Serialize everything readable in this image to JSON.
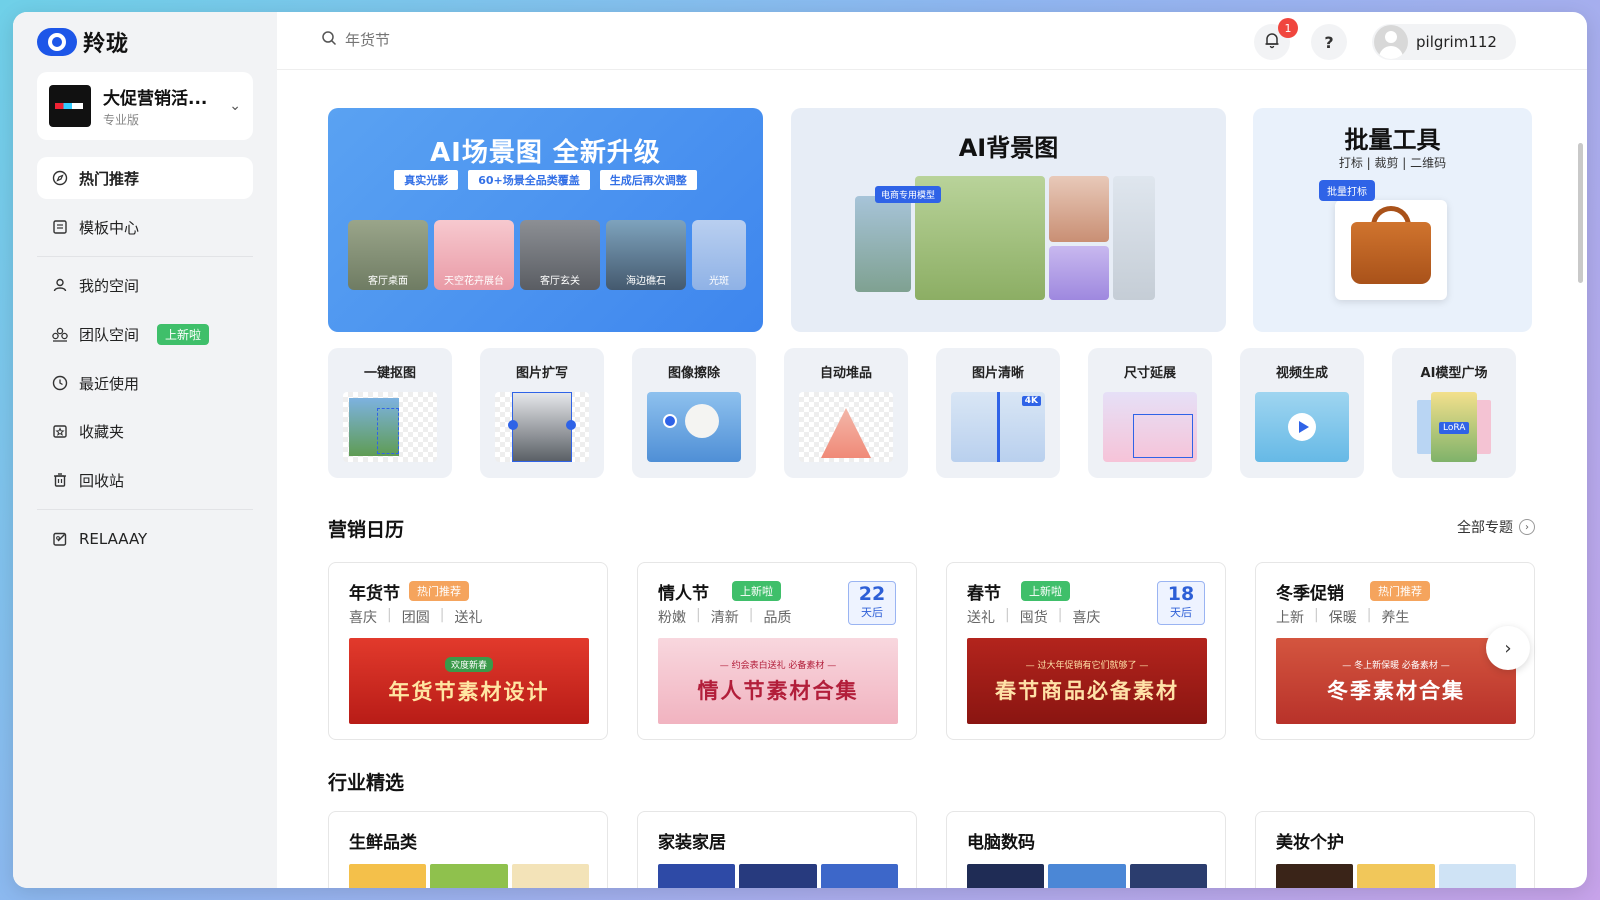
{
  "app": {
    "name": "羚珑"
  },
  "workspace": {
    "name": "大促营销活...",
    "plan": "专业版"
  },
  "sidebar": {
    "items": [
      {
        "label": "热门推荐",
        "icon": "compass-icon",
        "active": true
      },
      {
        "label": "模板中心",
        "icon": "template-icon"
      },
      {
        "label": "我的空间",
        "icon": "user-icon"
      },
      {
        "label": "团队空间",
        "icon": "team-icon",
        "badge": "上新啦"
      },
      {
        "label": "最近使用",
        "icon": "clock-icon"
      },
      {
        "label": "收藏夹",
        "icon": "star-folder-icon"
      },
      {
        "label": "回收站",
        "icon": "trash-icon"
      },
      {
        "label": "RELAAAY",
        "icon": "edit-square-icon"
      }
    ]
  },
  "header": {
    "search_placeholder": "年货节",
    "notification_count": "1",
    "help_label": "?",
    "username": "pilgrim112"
  },
  "banners": {
    "scene": {
      "title": "AI场景图 全新升级",
      "tags": [
        "真实光影",
        "60+场景全品类覆盖",
        "生成后再次调整"
      ],
      "thumbs": [
        "客厅桌面",
        "天空花卉展台",
        "客厅玄关",
        "海边礁石",
        "光斑"
      ]
    },
    "background": {
      "title": "AI背景图",
      "tag": "电商专用模型"
    },
    "batch": {
      "title": "批量工具",
      "subtitle": "打标 | 裁剪 | 二维码",
      "tag": "批量打标"
    }
  },
  "tools": [
    "一键抠图",
    "图片扩写",
    "图像擦除",
    "自动堆品",
    "图片清晰",
    "尺寸延展",
    "视频生成",
    "AI模型广场"
  ],
  "tool_badges": {
    "clarity": "4K",
    "model": "LoRA"
  },
  "calendar": {
    "title": "营销日历",
    "all_link": "全部专题",
    "cards": [
      {
        "name": "年货节",
        "badge": "热门推荐",
        "badge_type": "hot",
        "keywords": [
          "喜庆",
          "团圆",
          "送礼"
        ],
        "image_small": "欢度新春",
        "image_text": "年货节素材设计"
      },
      {
        "name": "情人节",
        "badge": "上新啦",
        "badge_type": "new",
        "keywords": [
          "粉嫩",
          "清新",
          "品质"
        ],
        "days": "22",
        "days_unit": "天后",
        "image_small": "— 约会表白送礼 必备素材 —",
        "image_text": "情人节素材合集"
      },
      {
        "name": "春节",
        "badge": "上新啦",
        "badge_type": "new",
        "keywords": [
          "送礼",
          "囤货",
          "喜庆"
        ],
        "days": "18",
        "days_unit": "天后",
        "image_small": "— 过大年促销有它们就够了 —",
        "image_text": "春节商品必备素材"
      },
      {
        "name": "冬季促销",
        "badge": "热门推荐",
        "badge_type": "hot",
        "keywords": [
          "上新",
          "保暖",
          "养生"
        ],
        "image_small": "— 冬上新保暖 必备素材 —",
        "image_text": "冬季素材合集"
      }
    ]
  },
  "industry": {
    "title": "行业精选",
    "cards": [
      "生鲜品类",
      "家装家居",
      "电脑数码",
      "美妆个护"
    ]
  },
  "colors": {
    "accent": "#1d56e8",
    "hot": "#f5a45d",
    "new": "#3fbf6a"
  }
}
